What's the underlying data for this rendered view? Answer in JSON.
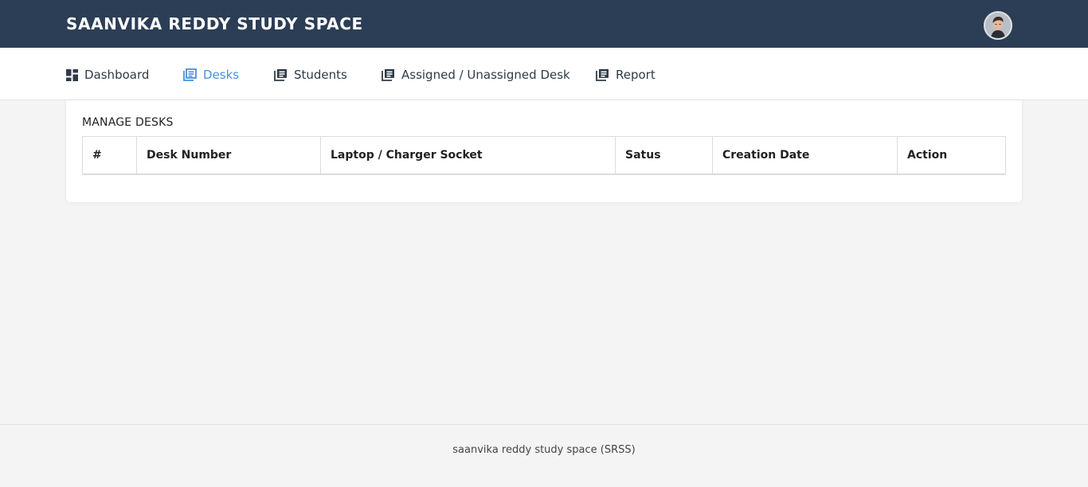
{
  "app": {
    "title": "SAANVIKA REDDY STUDY SPACE",
    "accent_color": "#4a90d9",
    "header_color": "#2c3e55"
  },
  "header": {
    "avatar_icon": "user-avatar-icon"
  },
  "nav": {
    "items": [
      {
        "label": "Dashboard",
        "icon": "dashboard-grid-icon",
        "active": false
      },
      {
        "label": "Desks",
        "icon": "library-books-icon",
        "active": true
      },
      {
        "label": "Students",
        "icon": "library-books-icon",
        "active": false
      },
      {
        "label": "Assigned / Unassigned Desk",
        "icon": "library-books-icon",
        "active": false
      },
      {
        "label": "Report",
        "icon": "library-books-icon",
        "active": false
      }
    ]
  },
  "main": {
    "card_title": "MANAGE DESKS",
    "table": {
      "columns": [
        "#",
        "Desk Number",
        "Laptop / Charger Socket",
        "Satus",
        "Creation Date",
        "Action"
      ],
      "rows": []
    }
  },
  "footer": {
    "text": "saanvika reddy study space (SRSS)"
  }
}
